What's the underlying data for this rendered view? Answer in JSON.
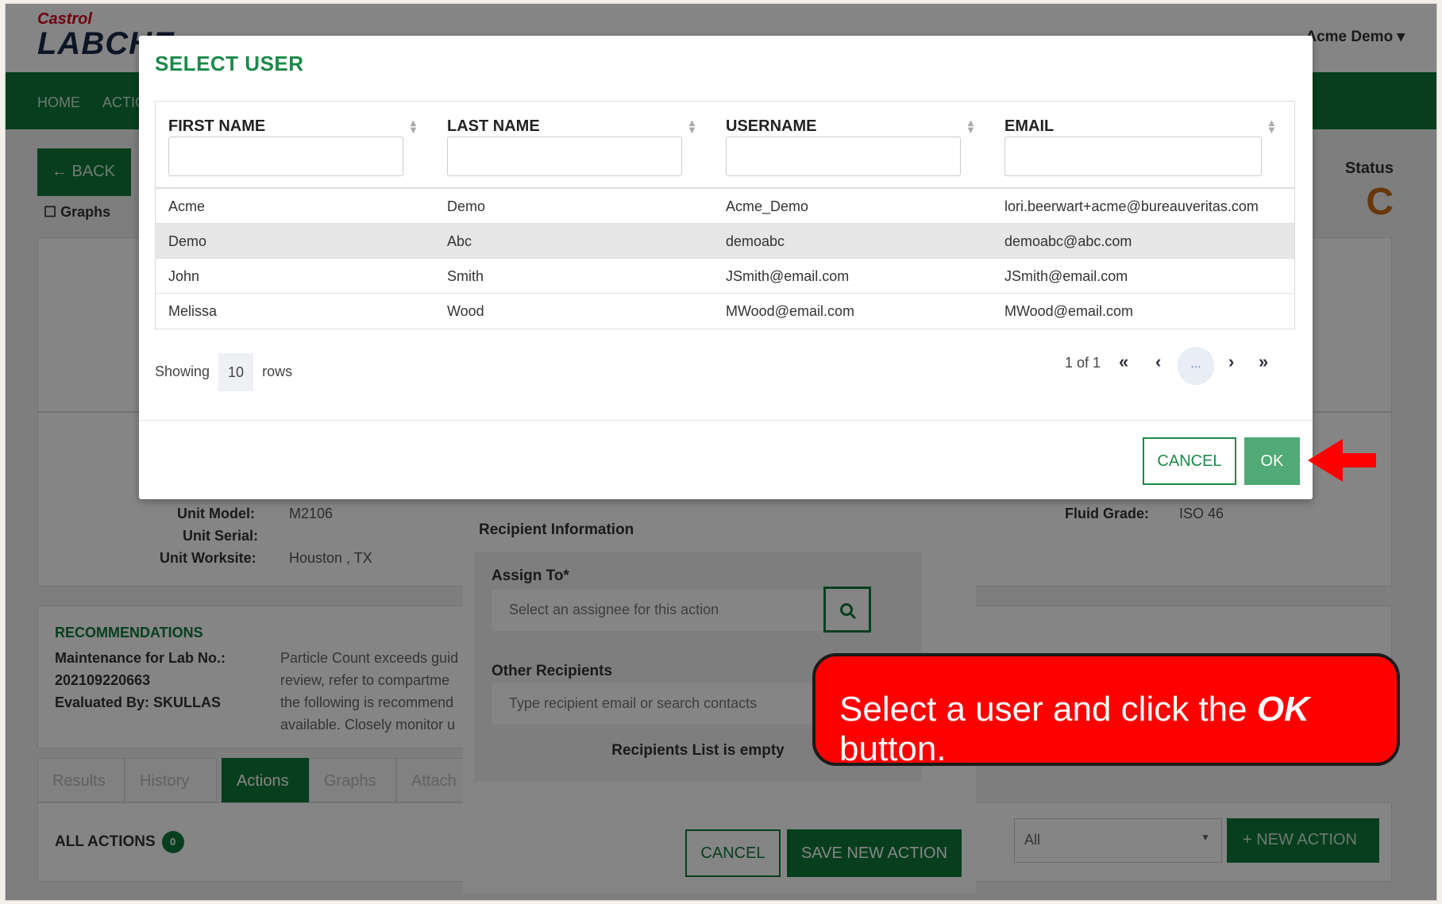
{
  "app": {
    "brand": "Castrol",
    "name": "LABCHE",
    "user_menu": "Acme Demo ▾"
  },
  "nav": {
    "home": "HOME",
    "actions": "ACTIO"
  },
  "page": {
    "back_label": "← BACK",
    "graphs_checkbox": "Graphs",
    "status_label": "Status",
    "status_value": "C",
    "unit_model_label": "Unit Model:",
    "unit_model_value": "M2106",
    "unit_serial_label": "Unit Serial:",
    "unit_worksite_label": "Unit Worksite:",
    "unit_worksite_value": "Houston , TX",
    "fluid_grade_label": "Fluid Grade:",
    "fluid_grade_value": "ISO 46",
    "recommendations_title": "RECOMMENDATIONS",
    "rec_lines": [
      "Maintenance for Lab No.:",
      "202109220663",
      "Evaluated By: SKULLAS"
    ],
    "rec_text": [
      "Particle Count exceeds guid",
      "review, refer to compartme",
      "the following is recommend",
      "available. Closely monitor u"
    ],
    "tabs": [
      "Results",
      "History",
      "Actions",
      "Graphs",
      "Attach"
    ],
    "all_actions_label": "ALL ACTIONS",
    "all_actions_count": "0",
    "filter_value": "All",
    "new_action_label": "+ NEW ACTION"
  },
  "new_action_modal": {
    "recipient_title": "Recipient Information",
    "assign_label": "Assign To*",
    "assign_placeholder": "Select an assignee for this action",
    "other_label": "Other Recipients",
    "other_placeholder": "Type recipient email or search contacts",
    "empty_label": "Recipients List is empty",
    "cancel_label": "CANCEL",
    "save_label": "SAVE NEW ACTION"
  },
  "select_user_modal": {
    "title": "SELECT USER",
    "columns": [
      "FIRST NAME",
      "LAST NAME",
      "USERNAME",
      "EMAIL"
    ],
    "rows": [
      [
        "Acme",
        "Demo",
        "Acme_Demo",
        "lori.beerwart+acme@bureauveritas.com"
      ],
      [
        "Demo",
        "Abc",
        "demoabc",
        "demoabc@abc.com"
      ],
      [
        "John",
        "Smith",
        "JSmith@email.com",
        "JSmith@email.com"
      ],
      [
        "Melissa",
        "Wood",
        "MWood@email.com",
        "MWood@email.com"
      ]
    ],
    "selected_row_index": 1,
    "showing_prefix": "Showing",
    "rows_per_page": "10",
    "showing_suffix": "rows",
    "page_info": "1 of 1",
    "page_first": "«",
    "page_prev": "‹",
    "page_current": "...",
    "page_next": "›",
    "page_last": "»",
    "cancel_label": "CANCEL",
    "ok_label": "OK"
  },
  "callout": {
    "text_before": "Select a user and click the ",
    "text_emphasis": "OK",
    "text_after": " button."
  },
  "colors": {
    "brand_green": "#0f7a3a",
    "ok_green": "#4faa76",
    "callout_red": "#ff0000"
  }
}
